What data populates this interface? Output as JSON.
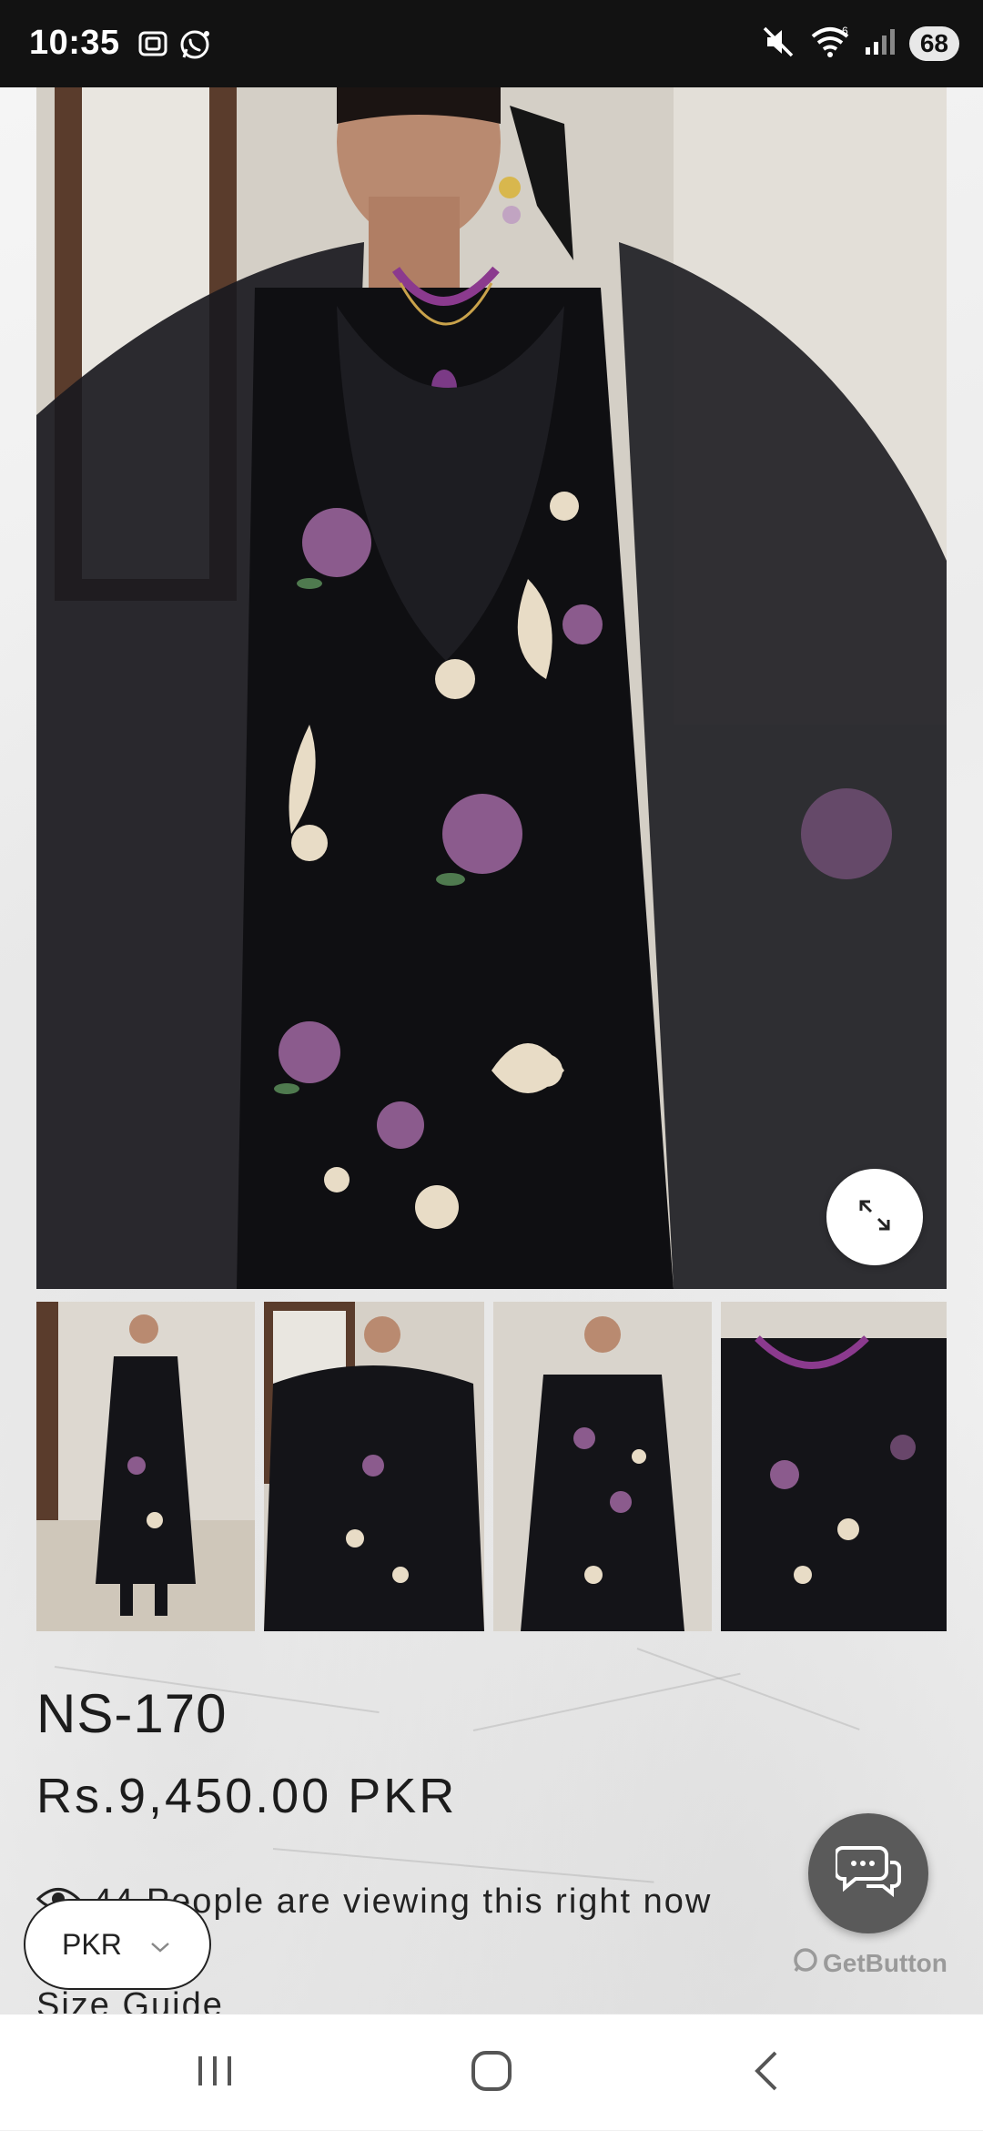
{
  "status_bar": {
    "time": "10:35",
    "battery": "68",
    "icons": [
      "screenshot-icon",
      "whatsapp-icon",
      "mute-icon",
      "wifi-icon",
      "signal-icon"
    ]
  },
  "product": {
    "title": "NS-170",
    "price": "Rs.9,450.00 PKR",
    "viewers_text": "44 People are viewing this right now",
    "size_guide": "Size Guide"
  },
  "currency": {
    "selected": "PKR"
  },
  "chat": {
    "brand": "GetButton"
  },
  "gallery": {
    "thumbnail_count": 4
  },
  "colors": {
    "status_bar_bg": "#121212",
    "garment_black": "#0f0f12",
    "chat_fab": "#5a5a5a"
  }
}
